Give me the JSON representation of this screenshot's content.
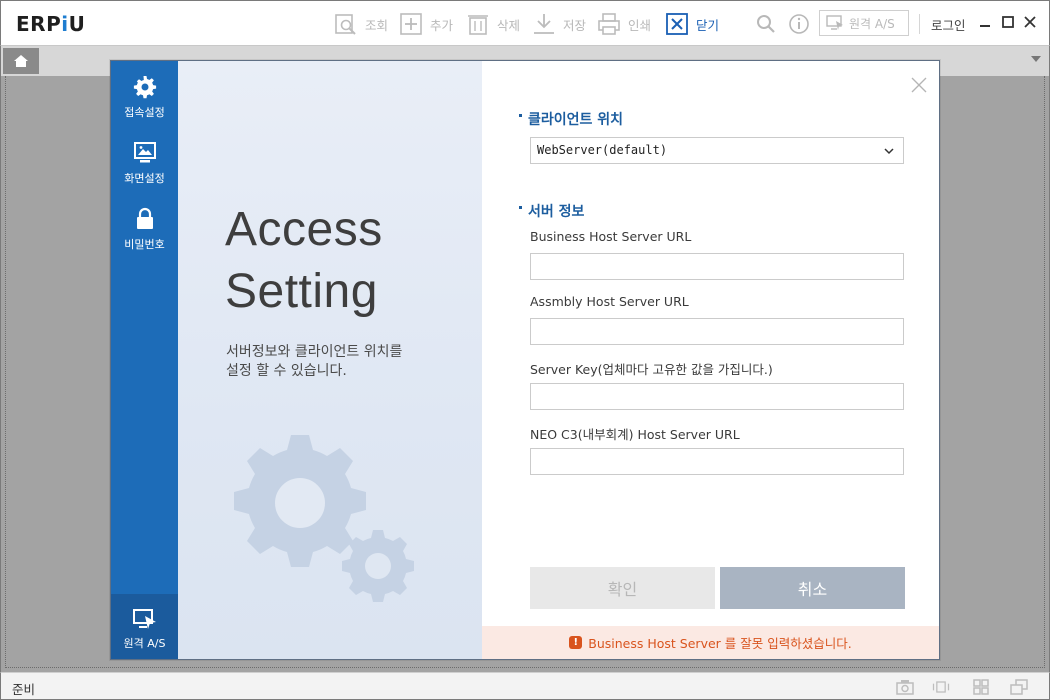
{
  "app": {
    "logo_prefix": "ERP",
    "logo_i": "i",
    "logo_suffix": "U"
  },
  "toolbar": {
    "inquire": "조회",
    "add": "추가",
    "delete": "삭제",
    "save": "저장",
    "print": "인쇄",
    "close": "닫기",
    "remote_as": "원격 A/S",
    "login": "로그인"
  },
  "dialog": {
    "nav": [
      {
        "label": "접속설정",
        "icon": "gear-icon"
      },
      {
        "label": "화면설정",
        "icon": "monitor-icon"
      },
      {
        "label": "비밀번호",
        "icon": "lock-icon"
      }
    ],
    "nav_bottom": {
      "label": "원격 A/S",
      "icon": "remote-monitor-icon"
    },
    "banner": {
      "title_line1": "Access",
      "title_line2": "Setting",
      "desc_line1": "서버정보와 클라이언트 위치를",
      "desc_line2": "설정 할 수 있습니다."
    },
    "client_section": {
      "title": "클라이언트 위치",
      "selected": "WebServer(default)"
    },
    "server_section": {
      "title": "서버 정보"
    },
    "fields": [
      {
        "label": "Business Host Server URL",
        "value": ""
      },
      {
        "label": "Assmbly Host Server URL",
        "value": ""
      },
      {
        "label": "Server Key(업체마다 고유한 값을 가집니다.)",
        "value": ""
      },
      {
        "label": "NEO C3(내부회계) Host Server URL",
        "value": ""
      }
    ],
    "buttons": {
      "confirm": "확인",
      "cancel": "취소"
    },
    "error_message": "Business Host Server 를 잘못 입력하셨습니다."
  },
  "statusbar": {
    "status": "준비"
  },
  "colors": {
    "accent": "#1d6cb8",
    "error": "#d9541e",
    "cancel_bg": "#a9b4c2"
  }
}
